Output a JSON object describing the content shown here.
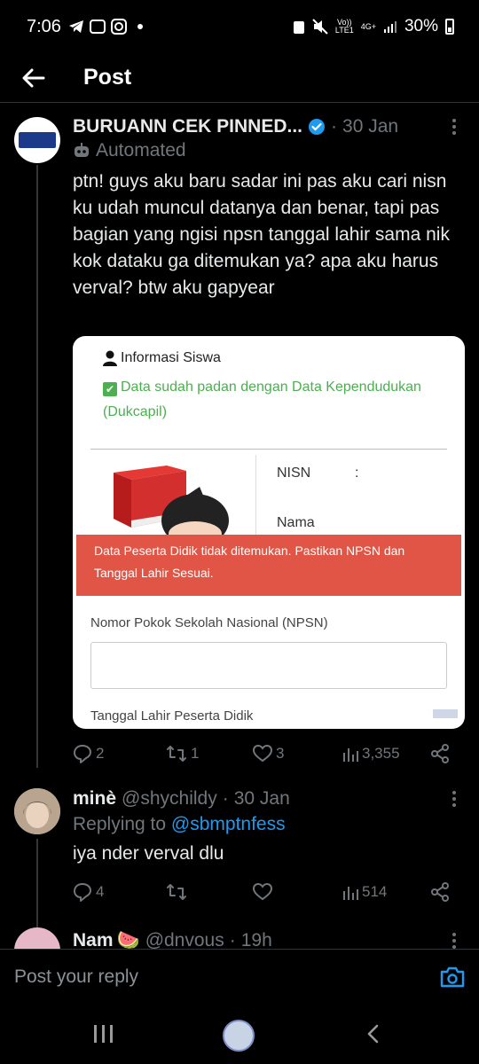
{
  "status_bar": {
    "time": "7:06",
    "network_top": "Vo))",
    "network_bottom": "LTE1",
    "signal_label": "4G+",
    "battery": "30%"
  },
  "header": {
    "title": "Post"
  },
  "main_post": {
    "display_name": "BURUANN CEK PINNED...",
    "separator": "·",
    "date": "30 Jan",
    "automated_label": "Automated",
    "text": "ptn! guys aku baru sadar ini pas aku cari nisn ku udah muncul datanya dan benar, tapi pas bagian yang ngisi npsn tanggal lahir sama nik kok dataku ga ditemukan ya? apa aku harus verval? btw aku gapyear",
    "media": {
      "title": "Informasi Siswa",
      "padan_text": "Data sudah padan dengan Data Kependudukan (Dukcapil)",
      "check_mark": "✔",
      "nisn_label": "NISN",
      "colon": ":",
      "nama_label": "Nama",
      "alert_text": "Data Peserta Didik tidak ditemukan. Pastikan NPSN dan Tanggal Lahir Sesuai.",
      "npsn_label": "Nomor Pokok Sekolah Nasional (NPSN)",
      "tgl_label": "Tanggal Lahir Peserta Didik"
    },
    "stats": {
      "replies": "2",
      "reposts": "1",
      "likes": "3",
      "views": "3,355"
    }
  },
  "reply": {
    "display_name": "minè",
    "handle": "@shychildy",
    "separator": "·",
    "date": "30 Jan",
    "replying_prefix": "Replying to",
    "replying_to": "@sbmptnfess",
    "text": "iya nder verval dlu",
    "stats": {
      "replies": "4",
      "views": "514"
    }
  },
  "next_reply": {
    "display_name": "Nam",
    "emoji": "🍉",
    "handle": "@dnvous",
    "separator": "·",
    "date": "19h"
  },
  "composer": {
    "placeholder": "Post your reply"
  },
  "colors": {
    "background": "#000000",
    "text": "#e7e9ea",
    "muted": "#71767b",
    "accent": "#1d9bf0",
    "alert": "#e05545",
    "success": "#4caf50"
  },
  "icons": [
    "back-arrow-icon",
    "verified-icon",
    "more-icon",
    "robot-icon",
    "reply-icon",
    "repost-icon",
    "like-icon",
    "views-icon",
    "share-icon",
    "camera-icon"
  ]
}
